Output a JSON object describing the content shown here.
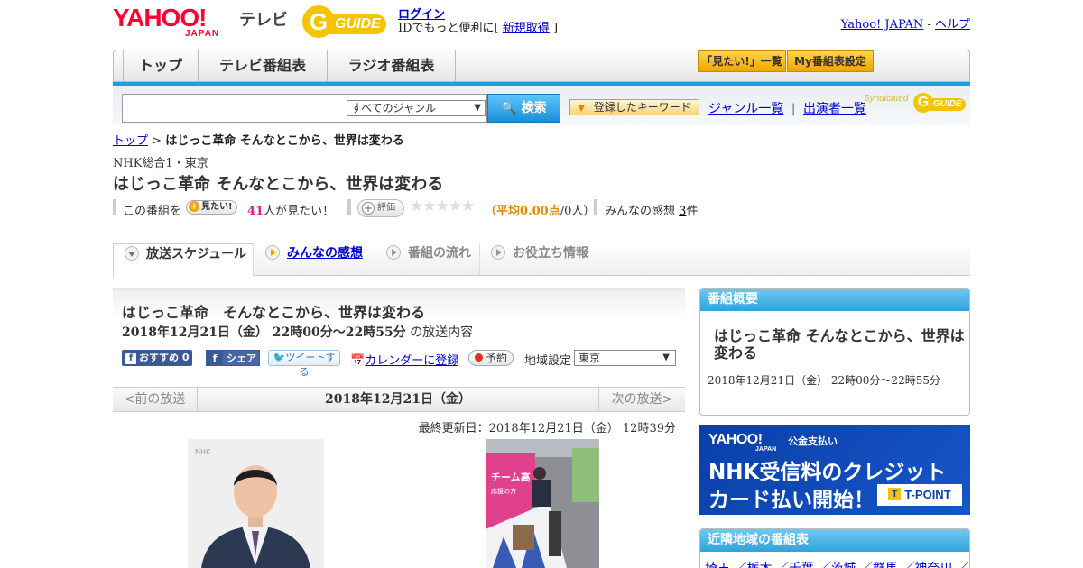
{
  "header": {
    "yahoo_logo": "YAHOO!",
    "yahoo_sub": "JAPAN",
    "tv_label": "テレビ",
    "gguide_logo": "GUIDE",
    "login": "ログイン",
    "id_text": "IDでもっと便利に[",
    "register": "新規取得",
    "id_close": "]",
    "yahoo_japan_link": "Yahoo! JAPAN",
    "help_link": "ヘルプ",
    "link_sep": "-"
  },
  "nav": {
    "top": "トップ",
    "tv_schedule": "テレビ番組表",
    "radio_schedule": "ラジオ番組表",
    "mitai_list": "「見たい!」一覧",
    "my_schedule": "My番組表設定"
  },
  "search": {
    "genre_selected": "すべてのジャンル",
    "search_button": "検索",
    "registered_keywords": "登録したキーワード",
    "genre_list": "ジャンル一覧",
    "performer_list": "出演者一覧",
    "syndicated": "Syndicated",
    "syn_guide": "GUIDE"
  },
  "breadcrumb": {
    "top": "トップ",
    "sep": ">",
    "current": "はじっこ革命 そんなとこから、世界は変わる"
  },
  "program": {
    "station": "NHK総合1・東京",
    "title": "はじっこ革命 そんなとこから、世界は変わる",
    "mitai_prefix": "この番組を",
    "mitai_button": "見たい!",
    "mitai_count": "41",
    "mitai_suffix": "人が見たい！",
    "rate_button": "評価",
    "stars": "★★★★★",
    "rating_prefix": "（",
    "rating_avg_label": "平均",
    "rating_value": "0.00",
    "rating_unit": "点",
    "rating_people": "/0人）",
    "impressions_label": "みんなの感想",
    "impressions_count": "3",
    "impressions_unit": "件"
  },
  "tabs": [
    {
      "label": "放送スケジュール"
    },
    {
      "label": "みんなの感想"
    },
    {
      "label": "番組の流れ"
    },
    {
      "label": "お役立ち情報"
    }
  ],
  "broadcast": {
    "title": "はじっこ革命　そんなとこから、世界は変わる",
    "datetime": "2018年12月21日（金） 22時00分～22時55分",
    "datetime_suffix": "の放送内容",
    "fb_recommend": "おすすめ 0",
    "fb_share": "シェア",
    "tweet": "ツイートする",
    "calendar": "カレンダーに登録",
    "reserve": "予約",
    "region_label": "地域設定",
    "region_value": "東京",
    "prev": "<前の放送",
    "current_date": "2018年12月21日（金）",
    "next": "次の放送>",
    "updated": "最終更新日：2018年12月21日（金） 12時39分"
  },
  "sidebar": {
    "overview_head": "番組概要",
    "overview_title": "はじっこ革命 そんなとこから、世界は変わる",
    "overview_date": "2018年12月21日（金） 22時00分～22時55分",
    "banner_yahoo": "YAHOO!",
    "banner_jp": "JAPAN",
    "banner_pay": "公金支払い",
    "banner_line1": "NHK受信料のクレジット",
    "banner_line2": "カード払い開始！",
    "banner_tpoint": "T-POINT",
    "nearby_head": "近隣地域の番組表",
    "nearby_links": "埼玉 ／栃木 ／千葉 ／茨城 ／群馬 ／神奈川 ／東"
  },
  "photo": {
    "nhk_mark": "NHK",
    "sign_text": "チーム高",
    "sign_sub": "応援の方"
  },
  "colors": {
    "accent_blue": "#1ba1e2",
    "yahoo_red": "#ff0033",
    "gguide_yellow": "#f5c400",
    "mitai_pink": "#e02087"
  }
}
